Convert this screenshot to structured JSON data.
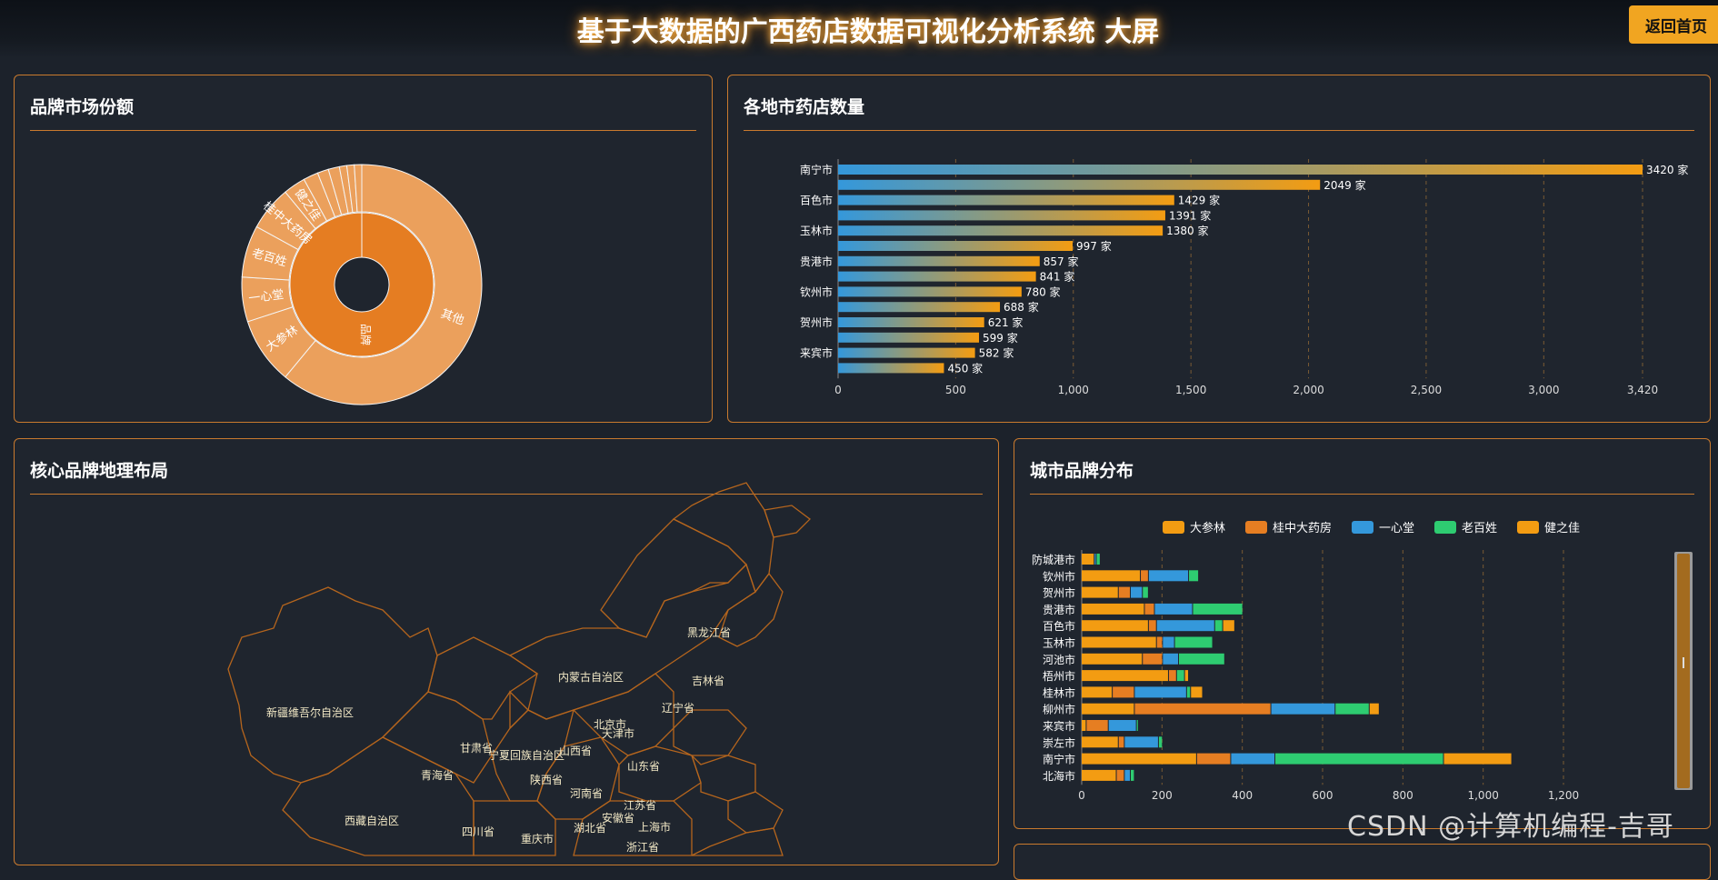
{
  "header": {
    "title": "基于大数据的广西药店数据可视化分析系统 大屏",
    "back_button": "返回首页"
  },
  "panels": {
    "brand_share": "品牌市场份额",
    "city_stores": "各地市药店数量",
    "geo": "核心品牌地理布局",
    "city_brand": "城市品牌分布"
  },
  "watermark": "CSDN @计算机编程-吉哥",
  "colors": {
    "accent": "#e8871e",
    "orange": "#f39c12",
    "blue": "#3498db",
    "green": "#2ecc71",
    "dark_orange": "#e67e22"
  },
  "chart_data": [
    {
      "id": "brand_share",
      "type": "sunburst",
      "inner": [
        {
          "label": "品牌",
          "value": 100
        }
      ],
      "outer": [
        {
          "label": "其他",
          "value": 61
        },
        {
          "label": "大参林",
          "value": 9
        },
        {
          "label": "一心堂",
          "value": 6
        },
        {
          "label": "老百姓",
          "value": 7
        },
        {
          "label": "桂中大药房",
          "value": 6
        },
        {
          "label": "健之佳",
          "value": 3
        },
        {
          "label": "",
          "value": 2
        },
        {
          "label": "",
          "value": 1.5
        },
        {
          "label": "",
          "value": 1.5
        },
        {
          "label": "",
          "value": 1
        },
        {
          "label": "",
          "value": 1
        },
        {
          "label": "",
          "value": 1
        }
      ]
    },
    {
      "id": "city_stores",
      "type": "bar",
      "orientation": "horizontal",
      "categories": [
        "南宁市",
        "",
        "百色市",
        "",
        "玉林市",
        "",
        "贵港市",
        "",
        "钦州市",
        "",
        "贺州市",
        "",
        "来宾市",
        ""
      ],
      "values": [
        3420,
        2049,
        1429,
        1391,
        1380,
        997,
        857,
        841,
        780,
        688,
        621,
        599,
        582,
        450
      ],
      "value_suffix": " 家",
      "xticks": [
        "0",
        "500",
        "1,000",
        "1,500",
        "2,000",
        "2,500",
        "3,000",
        "3,420"
      ],
      "xlim": [
        0,
        3420
      ]
    },
    {
      "id": "city_brand",
      "type": "bar",
      "orientation": "horizontal",
      "stacked": true,
      "categories": [
        "北海市",
        "南宁市",
        "崇左市",
        "来宾市",
        "柳州市",
        "桂林市",
        "梧州市",
        "河池市",
        "玉林市",
        "百色市",
        "贵港市",
        "贺州市",
        "钦州市",
        "防城港市"
      ],
      "series": [
        {
          "name": "大参林",
          "values": [
            85,
            285,
            90,
            10,
            130,
            75,
            215,
            150,
            185,
            165,
            155,
            90,
            145,
            30
          ]
        },
        {
          "name": "桂中大药房",
          "values": [
            20,
            85,
            15,
            55,
            340,
            55,
            20,
            50,
            15,
            20,
            25,
            30,
            20,
            0
          ]
        },
        {
          "name": "一心堂",
          "values": [
            15,
            110,
            85,
            70,
            160,
            130,
            0,
            40,
            30,
            145,
            95,
            30,
            100,
            5
          ]
        },
        {
          "name": "老百姓",
          "values": [
            10,
            420,
            10,
            5,
            85,
            10,
            20,
            115,
            95,
            20,
            125,
            15,
            25,
            10
          ]
        },
        {
          "name": "健之佳",
          "values": [
            0,
            170,
            0,
            0,
            25,
            30,
            10,
            0,
            0,
            30,
            0,
            0,
            0,
            0
          ]
        }
      ],
      "xticks": [
        "0",
        "200",
        "400",
        "600",
        "800",
        "1,000",
        "1,200"
      ],
      "xlim": [
        0,
        1200
      ]
    },
    {
      "id": "geo",
      "type": "map",
      "regions": [
        "新疆维吾尔自治区",
        "西藏自治区",
        "青海省",
        "甘肃省",
        "内蒙古自治区",
        "宁夏回族自治区",
        "山西省",
        "陕西省",
        "四川省",
        "重庆市",
        "湖北省",
        "河南省",
        "山东省",
        "江苏省",
        "安徽省",
        "上海市",
        "浙江省",
        "北京市",
        "天津市",
        "辽宁省",
        "吉林省",
        "黑龙江省"
      ]
    }
  ]
}
